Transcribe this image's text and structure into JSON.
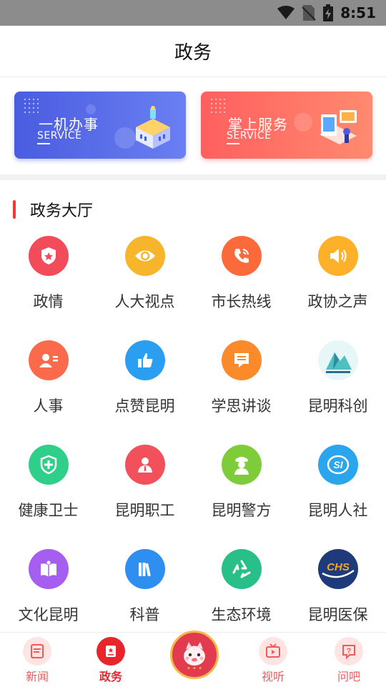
{
  "status_bar": {
    "time": "8:51"
  },
  "header": {
    "title": "政务"
  },
  "banners": [
    {
      "title": "一机办事",
      "subtitle": "SERVICE"
    },
    {
      "title": "掌上服务",
      "subtitle": "SERVICE"
    }
  ],
  "section": {
    "title": "政务大厅"
  },
  "services": [
    {
      "label": "政情",
      "icon": "shield-star-icon",
      "color": "#f24b5a"
    },
    {
      "label": "人大视点",
      "icon": "eye-icon",
      "color": "#f7b52b"
    },
    {
      "label": "市长热线",
      "icon": "phone-icon",
      "color": "#fb6a3a"
    },
    {
      "label": "政协之声",
      "icon": "speaker-icon",
      "color": "#fdb02a"
    },
    {
      "label": "人事",
      "icon": "id-card-icon",
      "color": "#fb6a4a"
    },
    {
      "label": "点赞昆明",
      "icon": "thumbs-up-icon",
      "color": "#2a9ef0"
    },
    {
      "label": "学思讲谈",
      "icon": "chat-document-icon",
      "color": "#fb8a2b"
    },
    {
      "label": "昆明科创",
      "icon": "kunming-science-logo-icon",
      "color": "#4fbfc0"
    },
    {
      "label": "健康卫士",
      "icon": "health-shield-icon",
      "color": "#2fcf8a"
    },
    {
      "label": "昆明职工",
      "icon": "worker-icon",
      "color": "#f2505a"
    },
    {
      "label": "昆明警方",
      "icon": "police-icon",
      "color": "#7fcc3a"
    },
    {
      "label": "昆明人社",
      "icon": "social-security-icon",
      "color": "#2aa5ee"
    },
    {
      "label": "文化昆明",
      "icon": "book-icon",
      "color": "#a55ef0"
    },
    {
      "label": "科普",
      "icon": "books-icon",
      "color": "#2f8ff0"
    },
    {
      "label": "生态环境",
      "icon": "recycle-icon",
      "color": "#28c088"
    },
    {
      "label": "昆明医保",
      "icon": "chs-logo-icon",
      "color": "#1e3a7a"
    }
  ],
  "tabs": [
    {
      "label": "新闻",
      "icon": "news-icon"
    },
    {
      "label": "政务",
      "icon": "government-icon"
    },
    {
      "label": "",
      "icon": "mascot-icon"
    },
    {
      "label": "视听",
      "icon": "tv-icon"
    },
    {
      "label": "问吧",
      "icon": "question-icon"
    }
  ]
}
